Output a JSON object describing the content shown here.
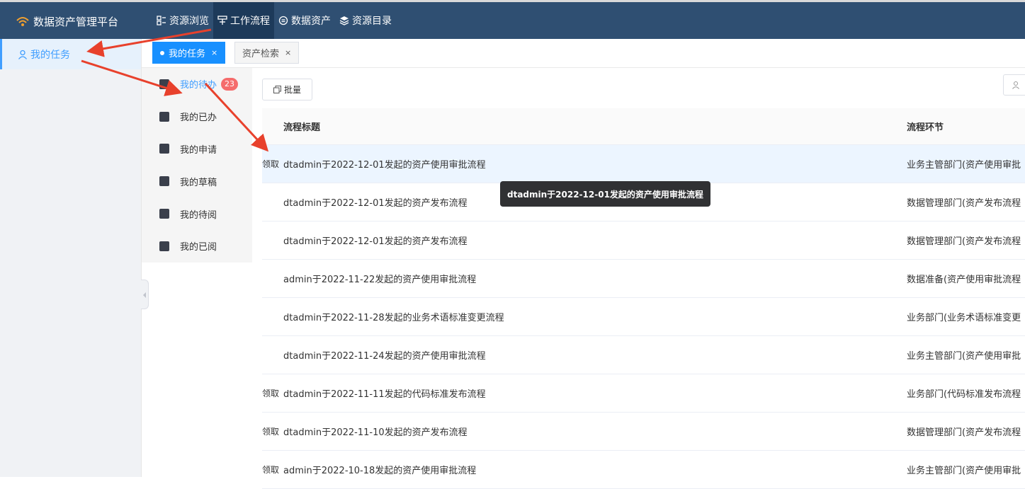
{
  "app": {
    "title": "数据资产管理平台"
  },
  "nav": [
    {
      "label": "资源浏览",
      "icon": "grid-list-icon"
    },
    {
      "label": "工作流程",
      "icon": "workflow-icon"
    },
    {
      "label": "数据资产",
      "icon": "data-asset-icon"
    },
    {
      "label": "资源目录",
      "icon": "layers-icon"
    }
  ],
  "sidebar": {
    "items": [
      {
        "label": "我的任务",
        "icon": "user-icon"
      }
    ]
  },
  "tabs": [
    {
      "label": "我的任务",
      "close": "×"
    },
    {
      "label": "资产检索",
      "close": "×"
    }
  ],
  "submenu": [
    {
      "label": "我的待办",
      "icon": "todo-icon",
      "badge": "23"
    },
    {
      "label": "我的已办",
      "icon": "done-icon"
    },
    {
      "label": "我的申请",
      "icon": "apply-icon"
    },
    {
      "label": "我的草稿",
      "icon": "draft-icon"
    },
    {
      "label": "我的待阅",
      "icon": "unread-icon"
    },
    {
      "label": "我的已阅",
      "icon": "read-icon"
    }
  ],
  "toolbar": {
    "batch_label": "批量"
  },
  "table": {
    "headers": {
      "title": "流程标题",
      "node": "流程环节"
    },
    "rows": [
      {
        "action": "领取",
        "title": "dtadmin于2022-12-01发起的资产使用审批流程",
        "node": "业务主管部门(资产使用审批"
      },
      {
        "action": "",
        "title": "dtadmin于2022-12-01发起的资产发布流程",
        "node": "数据管理部门(资产发布流程"
      },
      {
        "action": "",
        "title": "dtadmin于2022-12-01发起的资产发布流程",
        "node": "数据管理部门(资产发布流程"
      },
      {
        "action": "",
        "title": "admin于2022-11-22发起的资产使用审批流程",
        "node": "数据准备(资产使用审批流程"
      },
      {
        "action": "",
        "title": "dtadmin于2022-11-28发起的业务术语标准变更流程",
        "node": "业务部门(业务术语标准变更"
      },
      {
        "action": "",
        "title": "dtadmin于2022-11-24发起的资产使用审批流程",
        "node": "业务主管部门(资产使用审批"
      },
      {
        "action": "领取",
        "title": "dtadmin于2022-11-11发起的代码标准发布流程",
        "node": "业务部门(代码标准发布流程"
      },
      {
        "action": "领取",
        "title": "dtadmin于2022-11-10发起的资产发布流程",
        "node": "数据管理部门(资产发布流程"
      },
      {
        "action": "领取",
        "title": "admin于2022-10-18发起的资产使用审批流程",
        "node": "业务主管部门(资产使用审批"
      }
    ]
  },
  "tooltip": {
    "text": "dtadmin于2022-12-01发起的资产使用审批流程"
  },
  "colors": {
    "topbar": "#2f4f72",
    "accent": "#1890ff",
    "badge": "#f56c6c",
    "annotation_arrow": "#e8412c"
  }
}
